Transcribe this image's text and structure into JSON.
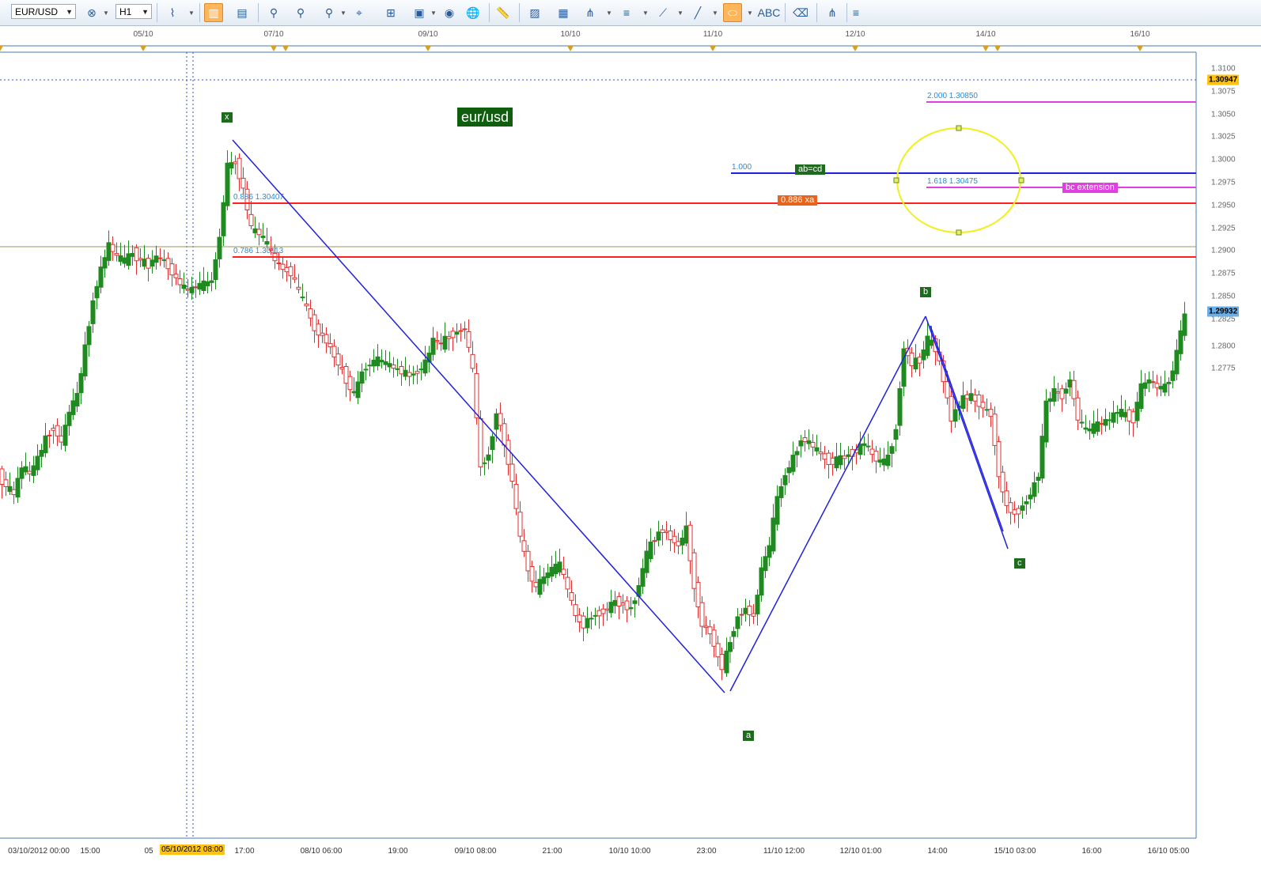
{
  "toolbar": {
    "symbol": "EUR/USD",
    "timeframe": "H1",
    "icons": [
      "indicators-icon",
      "timeframe-icon",
      "line-chart-icon",
      "bar-chart-icon",
      "candle-chart-icon",
      "zoom-in-icon",
      "zoom-out-icon",
      "zoom-fit-icon",
      "crosshair-icon",
      "properties-icon",
      "visibility-icon",
      "globe-icon",
      "ruler-icon",
      "snapshot-icon",
      "template-icon",
      "fibonacci-icon",
      "channel-icon",
      "gann-fan-icon",
      "trend-line-icon",
      "ellipse-icon",
      "text-label-icon",
      "eraser-icon",
      "object-tree-icon",
      "more-icon"
    ]
  },
  "top_dates": [
    "05/10",
    "07/10",
    "09/10",
    "10/10",
    "11/10",
    "12/10",
    "14/10",
    "16/10"
  ],
  "bottom_labels": [
    "03/10/2012 00:00",
    "15:00",
    "05",
    "17:00",
    "08/10 06:00",
    "19:00",
    "09/10 08:00",
    "21:00",
    "10/10 10:00",
    "23:00",
    "11/10 12:00",
    "12/10 01:00",
    "14:00",
    "15/10 03:00",
    "16:00",
    "16/10 05:00"
  ],
  "bottom_cursor_label": "05/10/2012 08:00",
  "price_axis": [
    "1.3100",
    "1.3075",
    "1.3050",
    "1.3025",
    "1.3000",
    "1.2975",
    "1.2950",
    "1.2925",
    "1.2900",
    "1.2875",
    "1.2850",
    "1.2825",
    "1.2800",
    "1.2775"
  ],
  "price_flags": {
    "crosshair": "1.30947",
    "crosshair_color": "#ffc20e",
    "current": "1.29932",
    "current_color": "#6ab0e8"
  },
  "chart_title": "eur/usd",
  "points": {
    "x": "x",
    "a": "a",
    "b": "b",
    "c": "c"
  },
  "fib_labels": {
    "xa_886": "0.886 1.30407",
    "xa_786": "0.786 1.30113",
    "abcd": "1.000",
    "bc_1618": "1.618 1.30475",
    "bc_2000": "2.000 1.30850"
  },
  "tags": {
    "abcd": "ab=cd",
    "xa": "0.886 xa",
    "bc": "bc extension"
  },
  "colors": {
    "bull": "#1f8a1f",
    "bear": "#e03030",
    "pattern": "#2020e0",
    "red_level": "#ff2020",
    "magenta_level": "#e040e0",
    "ellipse": "#f0f020"
  }
}
